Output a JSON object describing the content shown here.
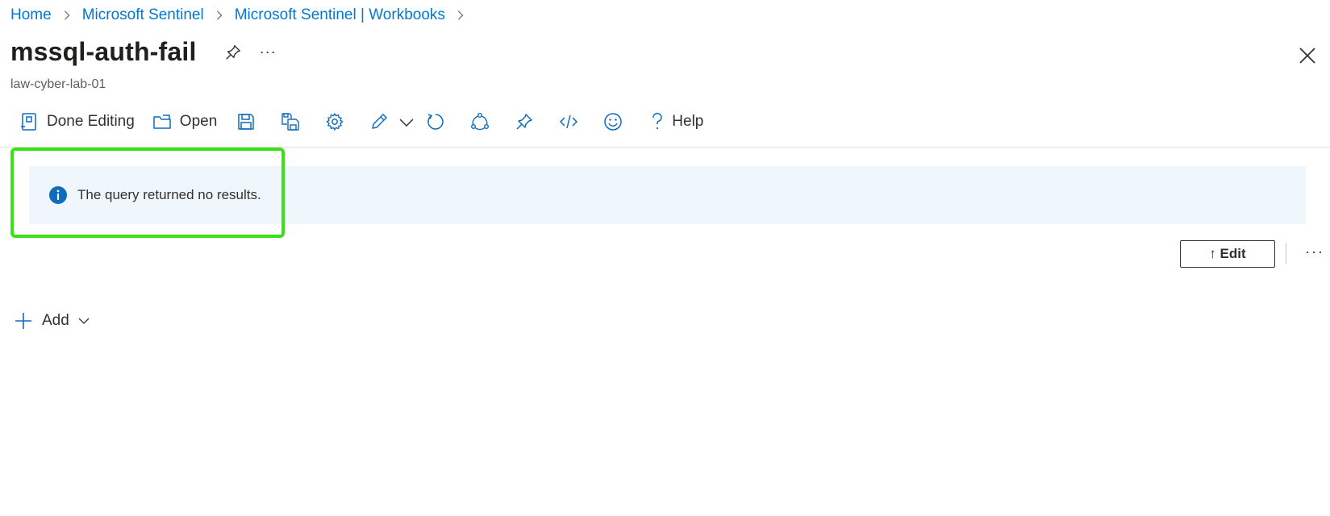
{
  "breadcrumb": {
    "items": [
      "Home",
      "Microsoft Sentinel",
      "Microsoft Sentinel | Workbooks"
    ]
  },
  "header": {
    "title": "mssql-auth-fail",
    "subtitle": "law-cyber-lab-01",
    "more_label": "···"
  },
  "toolbar": {
    "done_editing_label": "Done Editing",
    "open_label": "Open",
    "help_label": "Help"
  },
  "info": {
    "message": "The query returned no results."
  },
  "item_actions": {
    "edit_label": "↑ Edit",
    "more_label": "···"
  },
  "add": {
    "label": "Add"
  },
  "colors": {
    "link": "#0078d4",
    "info_bg": "#eff6fc",
    "info_icon": "#0f6cbd",
    "highlight": "#39e216"
  }
}
